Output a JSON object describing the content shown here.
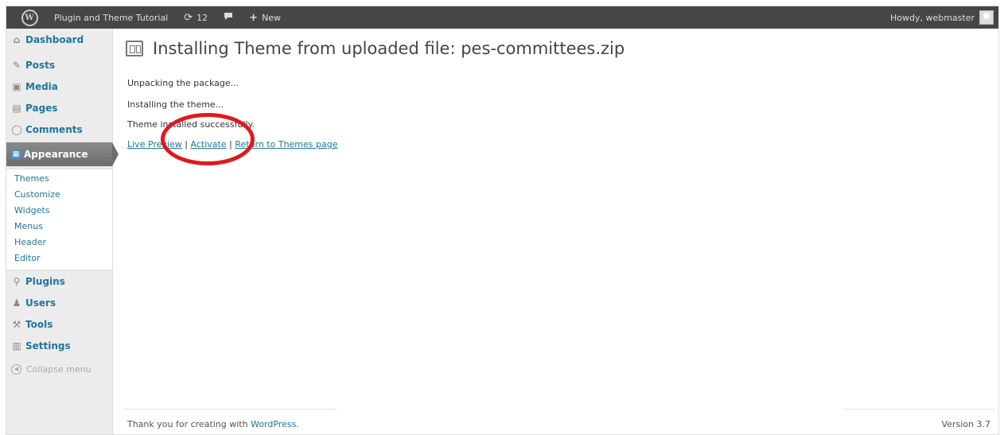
{
  "adminbar": {
    "wp_logo_icon": "wordpress-logo-icon",
    "site_name": "Plugin and Theme Tutorial",
    "updates_count": "12",
    "updates_icon": "refresh-icon",
    "comments_icon": "comment-bubble-icon",
    "new_label": "New",
    "new_icon": "plus-icon",
    "howdy": "Howdy, webmaster",
    "colors": {
      "bar_bg": "#464646",
      "bar_text": "#dddddd"
    }
  },
  "sidebar": {
    "items": [
      {
        "label": "Dashboard",
        "icon": "home-icon"
      },
      {
        "label": "Posts",
        "icon": "pin-icon"
      },
      {
        "label": "Media",
        "icon": "media-icon"
      },
      {
        "label": "Pages",
        "icon": "page-icon"
      },
      {
        "label": "Comments",
        "icon": "comment-icon"
      },
      {
        "label": "Appearance",
        "icon": "appearance-icon"
      },
      {
        "label": "Plugins",
        "icon": "plug-icon"
      },
      {
        "label": "Users",
        "icon": "users-icon"
      },
      {
        "label": "Tools",
        "icon": "tools-icon"
      },
      {
        "label": "Settings",
        "icon": "settings-icon"
      }
    ],
    "submenu": [
      "Themes",
      "Customize",
      "Widgets",
      "Menus",
      "Header",
      "Editor"
    ],
    "collapse": "Collapse menu",
    "colors": {
      "link": "#21759b",
      "current_bg": "#777777"
    }
  },
  "main": {
    "title": "Installing Theme from uploaded file: pes-committees.zip",
    "messages": [
      "Unpacking the package...",
      "Installing the theme...",
      "Theme installed successfully."
    ],
    "links": {
      "live_preview": "Live Preview",
      "activate": "Activate",
      "return": "Return to Themes page",
      "separator": "|"
    }
  },
  "footer": {
    "thanks_prefix": "Thank you for creating with ",
    "thanks_link": "WordPress",
    "thanks_suffix": ".",
    "version": "Version 3.7"
  },
  "annotation": {
    "color": "#e0181e"
  }
}
